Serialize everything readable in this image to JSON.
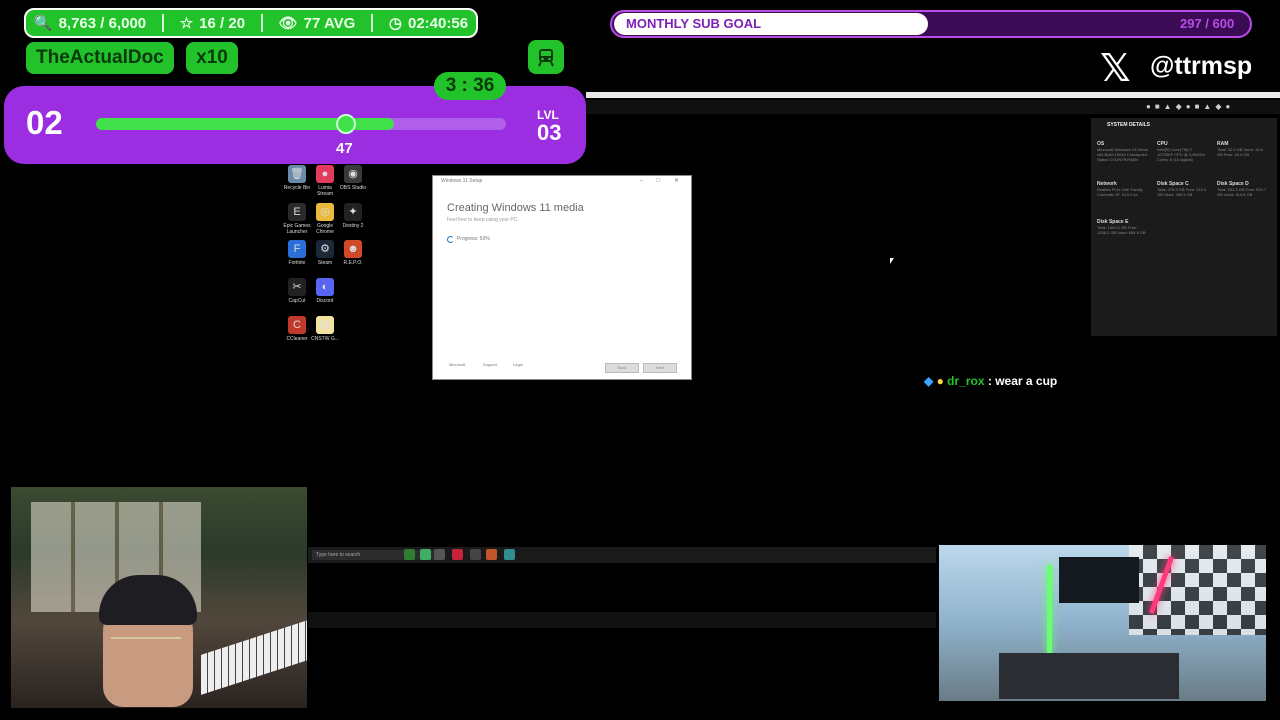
{
  "stats": {
    "points": "8,763 / 6,000",
    "stars": "16 / 20",
    "viewers": "77 AVG",
    "uptime": "02:40:56"
  },
  "user": {
    "name": "TheActualDoc",
    "multiplier": "x10"
  },
  "timer": "3 : 36",
  "level": {
    "current": "02",
    "progress": 47,
    "progress_fraction": 0.47,
    "next_label": "LVL",
    "next": "03"
  },
  "sub_goal": {
    "label": "MONTHLY SUB GOAL",
    "count": "297 / 600",
    "fraction": 0.495
  },
  "social": {
    "handle": "@ttrmsp"
  },
  "desktop_icons": [
    {
      "label": "Recycle Bin",
      "glyph": "🗑"
    },
    {
      "label": "Lumia Stream",
      "glyph": "●"
    },
    {
      "label": "OBS Studio",
      "glyph": "◉"
    },
    {
      "label": "Epic Games Launcher",
      "glyph": "E"
    },
    {
      "label": "Google Chrome",
      "glyph": "◎"
    },
    {
      "label": "Destiny 2",
      "glyph": "✦"
    },
    {
      "label": "Fortnite",
      "glyph": "F"
    },
    {
      "label": "Steam",
      "glyph": "⚙"
    },
    {
      "label": "R.E.P.O.",
      "glyph": "☻"
    },
    {
      "label": "CapCut",
      "glyph": "✂"
    },
    {
      "label": "Discord",
      "glyph": "◐"
    },
    {
      "label": "CCleaner",
      "glyph": "C"
    },
    {
      "label": "CNSTW G...",
      "glyph": "▤"
    }
  ],
  "setup_window": {
    "title": "Windows 11 Setup",
    "heading": "Creating Windows 11 media",
    "subtext": "Feel free to keep using your PC.",
    "progress": "Progress: 50%",
    "footer_brand": "Microsoft",
    "footer_support": "Support",
    "footer_legal": "Legal",
    "back_label": "Back",
    "next_label": "Next"
  },
  "system_details": {
    "title": "SYSTEM DETAILS",
    "cells": [
      {
        "title": "OS",
        "text": "Microsoft Windows 10 Home x64 Build 19045 Checkpoint Status COUNTRYMAN"
      },
      {
        "title": "CPU",
        "text": "Intel(R) Core(TM) i7 10700KF CPU @ 3.80GHz Cores: 8 (16 logical)"
      },
      {
        "title": "RAM",
        "text": "Total: 32.0 GB Used: 15.6 GB Free: 16.4 GB"
      },
      {
        "title": "Network",
        "text": "Realtek PCIe GbE Family Controller IP: 10.0.0.xx"
      },
      {
        "title": "Disk Space C",
        "text": "Total: 476.9 GB Free: 210.4 GB Used: 266.5 GB"
      },
      {
        "title": "Disk Space D",
        "text": "Total: 931.5 GB Free: 520.7 GB Used: 410.8 GB"
      },
      {
        "title": "Disk Space E",
        "text": "Total: 1863.0 GB Free: 1208.2 GB Used: 654.8 GB"
      }
    ]
  },
  "chat": {
    "user": "dr_rox",
    "separator": " : ",
    "message": "wear a cup"
  },
  "taskbar": {
    "search_placeholder": "Type here to search"
  },
  "colors": {
    "green": "#22c32a",
    "purple": "#9a2ee0",
    "sub_purple": "#b94ce8"
  }
}
